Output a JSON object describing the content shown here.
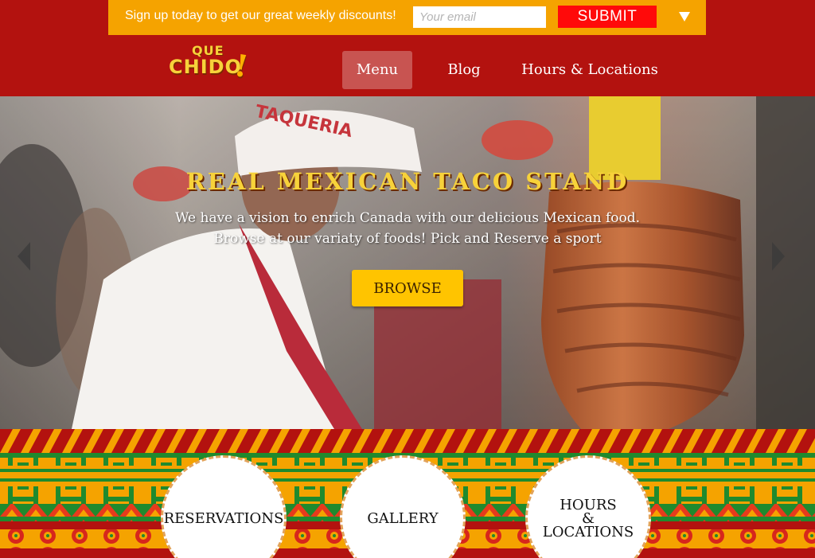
{
  "signup": {
    "text": "Sign up today to get our great weekly discounts!",
    "email_placeholder": "Your email",
    "submit_label": "SUBMIT"
  },
  "logo": {
    "line1": "QUE",
    "line2": "CHIDO",
    "bang": "!"
  },
  "nav": {
    "items": [
      {
        "label": "Menu",
        "active": true
      },
      {
        "label": "Blog",
        "active": false
      },
      {
        "label": "Hours & Locations",
        "active": false
      }
    ]
  },
  "hero": {
    "title": "REAL MEXICAN TACO STAND",
    "line1": "We have a vision to enrich Canada with our delicious Mexican food.",
    "line2": "Browse at our variaty of foods! Pick and Reserve a sport",
    "browse_label": "BROWSE"
  },
  "circles": {
    "reservations": "RESERVATIONS",
    "gallery": "GALLERY",
    "hours_line1": "HOURS",
    "hours_line2": "&",
    "hours_line3": "LOCATIONS"
  },
  "colors": {
    "header_red": "#b3120f",
    "signup_orange": "#f5a300",
    "submit_red": "#ff0a0a",
    "browse_yellow": "#ffc400",
    "title_yellow": "#f7d23a"
  },
  "icons": {
    "dropdown": "triangle-down-icon",
    "prev": "chevron-left-icon",
    "next": "chevron-right-icon"
  }
}
